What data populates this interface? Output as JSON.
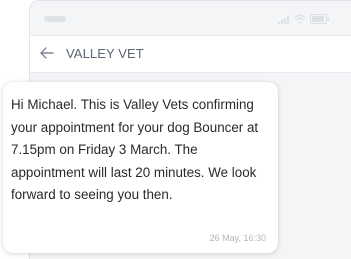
{
  "header": {
    "back_icon": "arrow-left-icon",
    "title": "VALLEY VET"
  },
  "status_bar": {
    "icons": [
      "signal-icon",
      "wifi-icon",
      "battery-icon"
    ]
  },
  "message": {
    "text": "Hi Michael. This is Valley Vets confirming your appointment for your dog Bouncer at 7.15pm on Friday 3 March. The appointment will last 20 minutes. We look forward to seeing you then.",
    "timestamp": "26 May, 16:30"
  },
  "colors": {
    "screen_background": "#f4f5f7",
    "header_text": "#5a6472",
    "message_text": "#2a2a2a",
    "timestamp_text": "#b3b6bb"
  }
}
